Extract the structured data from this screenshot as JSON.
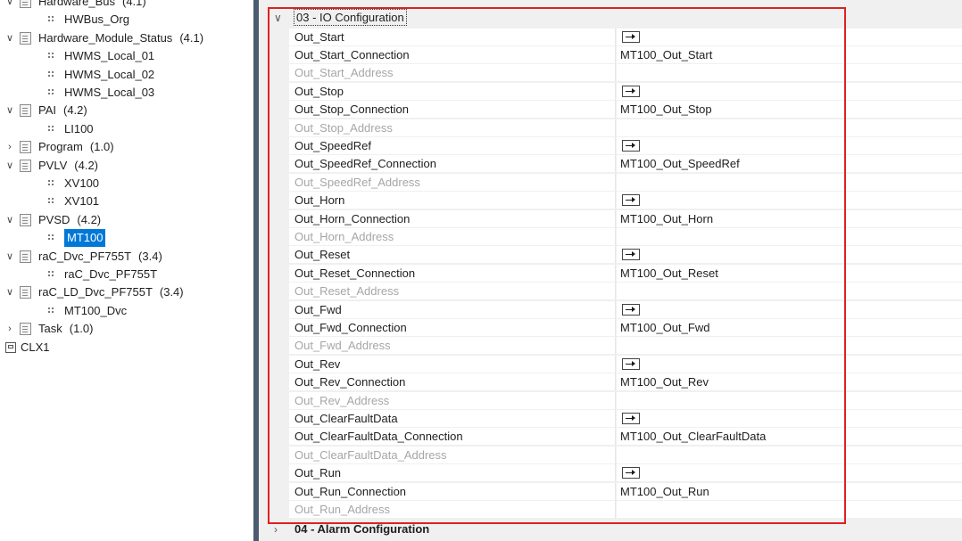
{
  "tree": [
    {
      "kind": "folder",
      "label": "Hardware_Bus",
      "version": "(4.1)",
      "expanded": true
    },
    {
      "kind": "leaf",
      "label": "HWBus_Org"
    },
    {
      "kind": "folder",
      "label": "Hardware_Module_Status",
      "version": "(4.1)",
      "expanded": true
    },
    {
      "kind": "leaf",
      "label": "HWMS_Local_01"
    },
    {
      "kind": "leaf",
      "label": "HWMS_Local_02"
    },
    {
      "kind": "leaf",
      "label": "HWMS_Local_03"
    },
    {
      "kind": "folder",
      "label": "PAI",
      "version": "(4.2)",
      "expanded": true
    },
    {
      "kind": "leaf",
      "label": "LI100"
    },
    {
      "kind": "folder",
      "label": "Program",
      "version": "(1.0)",
      "expanded": false
    },
    {
      "kind": "folder",
      "label": "PVLV",
      "version": "(4.2)",
      "expanded": true
    },
    {
      "kind": "leaf",
      "label": "XV100"
    },
    {
      "kind": "leaf",
      "label": "XV101"
    },
    {
      "kind": "folder",
      "label": "PVSD",
      "version": "(4.2)",
      "expanded": true
    },
    {
      "kind": "leaf",
      "label": "MT100",
      "selected": true
    },
    {
      "kind": "folder",
      "label": "raC_Dvc_PF755T",
      "version": "(3.4)",
      "expanded": true
    },
    {
      "kind": "leaf",
      "label": "raC_Dvc_PF755T"
    },
    {
      "kind": "folder",
      "label": "raC_LD_Dvc_PF755T",
      "version": "(3.4)",
      "expanded": true
    },
    {
      "kind": "leaf",
      "label": "MT100_Dvc"
    },
    {
      "kind": "folder",
      "label": "Task",
      "version": "(1.0)",
      "expanded": false
    },
    {
      "kind": "controller",
      "label": "CLX1"
    }
  ],
  "grid": {
    "category_03": "03 - IO Configuration",
    "category_04": "04 - Alarm Configuration",
    "rows": [
      {
        "name": "Out_Start",
        "value": "",
        "button": true
      },
      {
        "name": "Out_Start_Connection",
        "value": "MT100_Out_Start"
      },
      {
        "name": "Out_Start_Address",
        "value": "",
        "disabled": true
      },
      {
        "name": "Out_Stop",
        "value": "",
        "button": true
      },
      {
        "name": "Out_Stop_Connection",
        "value": "MT100_Out_Stop"
      },
      {
        "name": "Out_Stop_Address",
        "value": "",
        "disabled": true
      },
      {
        "name": "Out_SpeedRef",
        "value": "",
        "button": true
      },
      {
        "name": "Out_SpeedRef_Connection",
        "value": "MT100_Out_SpeedRef"
      },
      {
        "name": "Out_SpeedRef_Address",
        "value": "",
        "disabled": true
      },
      {
        "name": "Out_Horn",
        "value": "",
        "button": true
      },
      {
        "name": "Out_Horn_Connection",
        "value": "MT100_Out_Horn"
      },
      {
        "name": "Out_Horn_Address",
        "value": "",
        "disabled": true
      },
      {
        "name": "Out_Reset",
        "value": "",
        "button": true
      },
      {
        "name": "Out_Reset_Connection",
        "value": "MT100_Out_Reset"
      },
      {
        "name": "Out_Reset_Address",
        "value": "",
        "disabled": true
      },
      {
        "name": "Out_Fwd",
        "value": "",
        "button": true
      },
      {
        "name": "Out_Fwd_Connection",
        "value": "MT100_Out_Fwd"
      },
      {
        "name": "Out_Fwd_Address",
        "value": "",
        "disabled": true
      },
      {
        "name": "Out_Rev",
        "value": "",
        "button": true
      },
      {
        "name": "Out_Rev_Connection",
        "value": "MT100_Out_Rev"
      },
      {
        "name": "Out_Rev_Address",
        "value": "",
        "disabled": true
      },
      {
        "name": "Out_ClearFaultData",
        "value": "",
        "button": true
      },
      {
        "name": "Out_ClearFaultData_Connection",
        "value": "MT100_Out_ClearFaultData"
      },
      {
        "name": "Out_ClearFaultData_Address",
        "value": "",
        "disabled": true
      },
      {
        "name": "Out_Run",
        "value": "",
        "button": true
      },
      {
        "name": "Out_Run_Connection",
        "value": "MT100_Out_Run"
      },
      {
        "name": "Out_Run_Address",
        "value": "",
        "disabled": true
      }
    ]
  },
  "colors": {
    "highlight": "#e02020",
    "selection": "#0078d7",
    "splitter": "#4d5b6e"
  }
}
